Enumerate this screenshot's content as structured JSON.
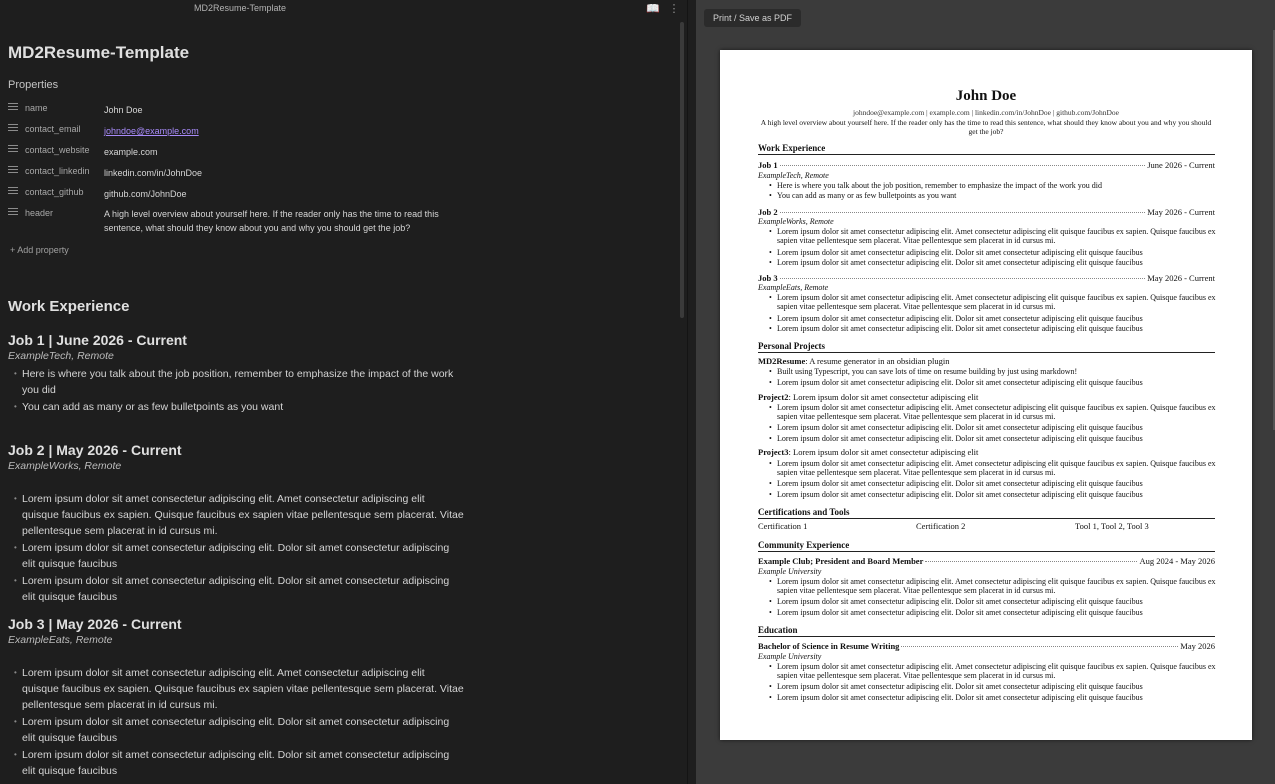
{
  "editor": {
    "tab_title": "MD2Resume-Template",
    "note_title": "MD2Resume-Template",
    "properties_heading": "Properties",
    "properties": [
      {
        "key": "name",
        "value": "John Doe"
      },
      {
        "key": "contact_email",
        "value": "johndoe@example.com"
      },
      {
        "key": "contact_website",
        "value": "example.com"
      },
      {
        "key": "contact_linkedin",
        "value": "linkedin.com/in/JohnDoe"
      },
      {
        "key": "contact_github",
        "value": "github.com/JohnDoe"
      },
      {
        "key": "header",
        "value": "A high level overview about yourself here. If the reader only has the time to read this sentence, what should they know about you and why you should get the job?"
      }
    ],
    "add_property": "Add property",
    "work_heading": "Work Experience",
    "jobs": [
      {
        "title": "Job 1 | June 2026 - Current",
        "org": "ExampleTech, Remote",
        "bullets": [
          "Here is where you talk about the job position, remember to emphasize the impact of the work you did",
          "You can add as many or as few bulletpoints as you want"
        ]
      },
      {
        "title": "Job 2 | May 2026 - Current",
        "org": "ExampleWorks, Remote",
        "bullets": [
          "Lorem ipsum dolor sit amet consectetur adipiscing elit. Amet consectetur adipiscing elit quisque faucibus ex sapien. Quisque faucibus ex sapien vitae pellentesque sem placerat. Vitae pellentesque sem placerat in id cursus mi.",
          "Lorem ipsum dolor sit amet consectetur adipiscing elit. Dolor sit amet consectetur adipiscing elit quisque faucibus",
          "Lorem ipsum dolor sit amet consectetur adipiscing elit. Dolor sit amet consectetur adipiscing elit quisque faucibus"
        ]
      },
      {
        "title": "Job 3 | May 2026 - Current",
        "org": "ExampleEats, Remote",
        "bullets": [
          "Lorem ipsum dolor sit amet consectetur adipiscing elit. Amet consectetur adipiscing elit quisque faucibus ex sapien. Quisque faucibus ex sapien vitae pellentesque sem placerat. Vitae pellentesque sem placerat in id cursus mi.",
          "Lorem ipsum dolor sit amet consectetur adipiscing elit. Dolor sit amet consectetur adipiscing elit quisque faucibus",
          "Lorem ipsum dolor sit amet consectetur adipiscing elit. Dolor sit amet consectetur adipiscing elit quisque faucibus"
        ]
      }
    ]
  },
  "preview": {
    "print_button": "Print / Save as PDF",
    "name": "John Doe",
    "contact": "johndoe@example.com | example.com | linkedin.com/in/JohnDoe | github.com/JohnDoe",
    "header": "A high level overview about yourself here. If the reader only has the time to read this sentence, what should they know about you and why you should get the job?",
    "sections": {
      "work": "Work Experience",
      "projects": "Personal Projects",
      "certs": "Certifications and Tools",
      "community": "Community Experience",
      "education": "Education"
    },
    "jobs": [
      {
        "title": "Job 1",
        "date": "June 2026 - Current",
        "org": "ExampleTech, Remote",
        "bullets": [
          "Here is where you talk about the job position, remember to emphasize the impact of the work you did",
          "You can add as many or as few bulletpoints as you want"
        ]
      },
      {
        "title": "Job 2",
        "date": "May 2026 - Current",
        "org": "ExampleWorks, Remote",
        "bullets": [
          "Lorem ipsum dolor sit amet consectetur adipiscing elit. Amet consectetur adipiscing elit quisque faucibus ex sapien. Quisque faucibus ex sapien vitae pellentesque sem placerat. Vitae pellentesque sem placerat in id cursus mi.",
          "Lorem ipsum dolor sit amet consectetur adipiscing elit. Dolor sit amet consectetur adipiscing elit quisque faucibus",
          "Lorem ipsum dolor sit amet consectetur adipiscing elit. Dolor sit amet consectetur adipiscing elit quisque faucibus"
        ]
      },
      {
        "title": "Job 3",
        "date": "May 2026 - Current",
        "org": "ExampleEats, Remote",
        "bullets": [
          "Lorem ipsum dolor sit amet consectetur adipiscing elit. Amet consectetur adipiscing elit quisque faucibus ex sapien. Quisque faucibus ex sapien vitae pellentesque sem placerat. Vitae pellentesque sem placerat in id cursus mi.",
          "Lorem ipsum dolor sit amet consectetur adipiscing elit. Dolor sit amet consectetur adipiscing elit quisque faucibus",
          "Lorem ipsum dolor sit amet consectetur adipiscing elit. Dolor sit amet consectetur adipiscing elit quisque faucibus"
        ]
      }
    ],
    "projects": [
      {
        "name": "MD2Resume",
        "desc": ": A resume generator in an obsidian plugin",
        "bullets": [
          "Built using Typescript, you can save lots of time on resume building by just using markdown!",
          "Lorem ipsum dolor sit amet consectetur adipiscing elit. Dolor sit amet consectetur adipiscing elit quisque faucibus"
        ]
      },
      {
        "name": "Project2",
        "desc": ": Lorem ipsum dolor sit amet consectetur adipiscing elit",
        "bullets": [
          "Lorem ipsum dolor sit amet consectetur adipiscing elit. Amet consectetur adipiscing elit quisque faucibus ex sapien. Quisque faucibus ex sapien vitae pellentesque sem placerat. Vitae pellentesque sem placerat in id cursus mi.",
          "Lorem ipsum dolor sit amet consectetur adipiscing elit. Dolor sit amet consectetur adipiscing elit quisque faucibus",
          "Lorem ipsum dolor sit amet consectetur adipiscing elit. Dolor sit amet consectetur adipiscing elit quisque faucibus"
        ]
      },
      {
        "name": "Project3",
        "desc": ": Lorem ipsum dolor sit amet consectetur adipiscing elit",
        "bullets": [
          "Lorem ipsum dolor sit amet consectetur adipiscing elit. Amet consectetur adipiscing elit quisque faucibus ex sapien. Quisque faucibus ex sapien vitae pellentesque sem placerat. Vitae pellentesque sem placerat in id cursus mi.",
          "Lorem ipsum dolor sit amet consectetur adipiscing elit. Dolor sit amet consectetur adipiscing elit quisque faucibus",
          "Lorem ipsum dolor sit amet consectetur adipiscing elit. Dolor sit amet consectetur adipiscing elit quisque faucibus"
        ]
      }
    ],
    "certs": [
      "Certification 1",
      "Certification 2",
      "Tool 1, Tool 2, Tool 3"
    ],
    "community": {
      "title": "Example Club; President and Board Member",
      "date": "Aug 2024 - May 2026",
      "org": "Example University",
      "bullets": [
        "Lorem ipsum dolor sit amet consectetur adipiscing elit. Amet consectetur adipiscing elit quisque faucibus ex sapien. Quisque faucibus ex sapien vitae pellentesque sem placerat. Vitae pellentesque sem placerat in id cursus mi.",
        "Lorem ipsum dolor sit amet consectetur adipiscing elit. Dolor sit amet consectetur adipiscing elit quisque faucibus",
        "Lorem ipsum dolor sit amet consectetur adipiscing elit. Dolor sit amet consectetur adipiscing elit quisque faucibus"
      ]
    },
    "education": {
      "title": "Bachelor of Science in Resume Writing",
      "date": "May 2026",
      "org": "Example University",
      "bullets": [
        "Lorem ipsum dolor sit amet consectetur adipiscing elit. Amet consectetur adipiscing elit quisque faucibus ex sapien. Quisque faucibus ex sapien vitae pellentesque sem placerat. Vitae pellentesque sem placerat in id cursus mi.",
        "Lorem ipsum dolor sit amet consectetur adipiscing elit. Dolor sit amet consectetur adipiscing elit quisque faucibus",
        "Lorem ipsum dolor sit amet consectetur adipiscing elit. Dolor sit amet consectetur adipiscing elit quisque faucibus"
      ]
    }
  }
}
